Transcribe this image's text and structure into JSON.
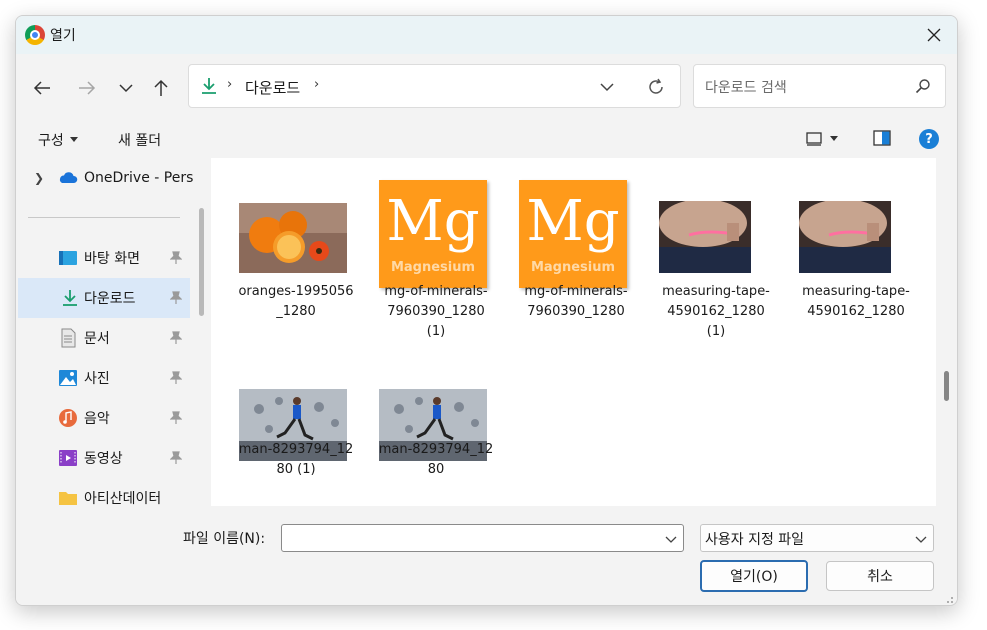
{
  "window": {
    "title": "열기"
  },
  "navigation": {
    "back_icon": "arrow-left-icon",
    "forward_icon": "arrow-right-icon",
    "recent_icon": "chevron-down-icon",
    "up_icon": "arrow-up-icon"
  },
  "address": {
    "separator": "›",
    "path": "다운로드",
    "trailing_separator": "›"
  },
  "search": {
    "placeholder": "다운로드 검색"
  },
  "toolbar": {
    "organize_label": "구성",
    "new_folder_label": "새 폴더",
    "help_label": "?"
  },
  "sidebar": {
    "onedrive_label": "OneDrive - Pers",
    "items": [
      {
        "label": "바탕 화면",
        "icon": "desktop-icon"
      },
      {
        "label": "다운로드",
        "icon": "download-icon",
        "selected": true
      },
      {
        "label": "문서",
        "icon": "document-icon"
      },
      {
        "label": "사진",
        "icon": "pictures-icon"
      },
      {
        "label": "음악",
        "icon": "music-icon"
      },
      {
        "label": "동영상",
        "icon": "video-icon"
      },
      {
        "label": "아티산데이터",
        "icon": "folder-icon"
      }
    ]
  },
  "files": [
    {
      "name_lines": [
        "oranges-1995056",
        "_1280"
      ],
      "thumb": "oranges"
    },
    {
      "name_lines": [
        "mg-of-minerals-",
        "7960390_1280",
        "(1)"
      ],
      "thumb": "magnesium"
    },
    {
      "name_lines": [
        "mg-of-minerals-",
        "7960390_1280"
      ],
      "thumb": "magnesium"
    },
    {
      "name_lines": [
        "measuring-tape-",
        "4590162_1280",
        "(1)"
      ],
      "thumb": "tape"
    },
    {
      "name_lines": [
        "measuring-tape-",
        "4590162_1280"
      ],
      "thumb": "tape"
    },
    {
      "name_lines": [
        "man-8293794_12",
        "80 (1)"
      ],
      "thumb": "runner"
    },
    {
      "name_lines": [
        "man-8293794_12",
        "80"
      ],
      "thumb": "runner"
    }
  ],
  "thumb_text": {
    "mg_symbol": "Mg",
    "mg_word": "Magnesium"
  },
  "bottom": {
    "filename_label": "파일 이름(N):",
    "filename_value": "",
    "filter_value": "사용자 지정 파일",
    "open_label": "열기(O)",
    "cancel_label": "취소"
  },
  "colors": {
    "accent": "#2b6cb0",
    "selected_bg": "#dae8f8",
    "orange_tile": "#ff9a1a"
  }
}
